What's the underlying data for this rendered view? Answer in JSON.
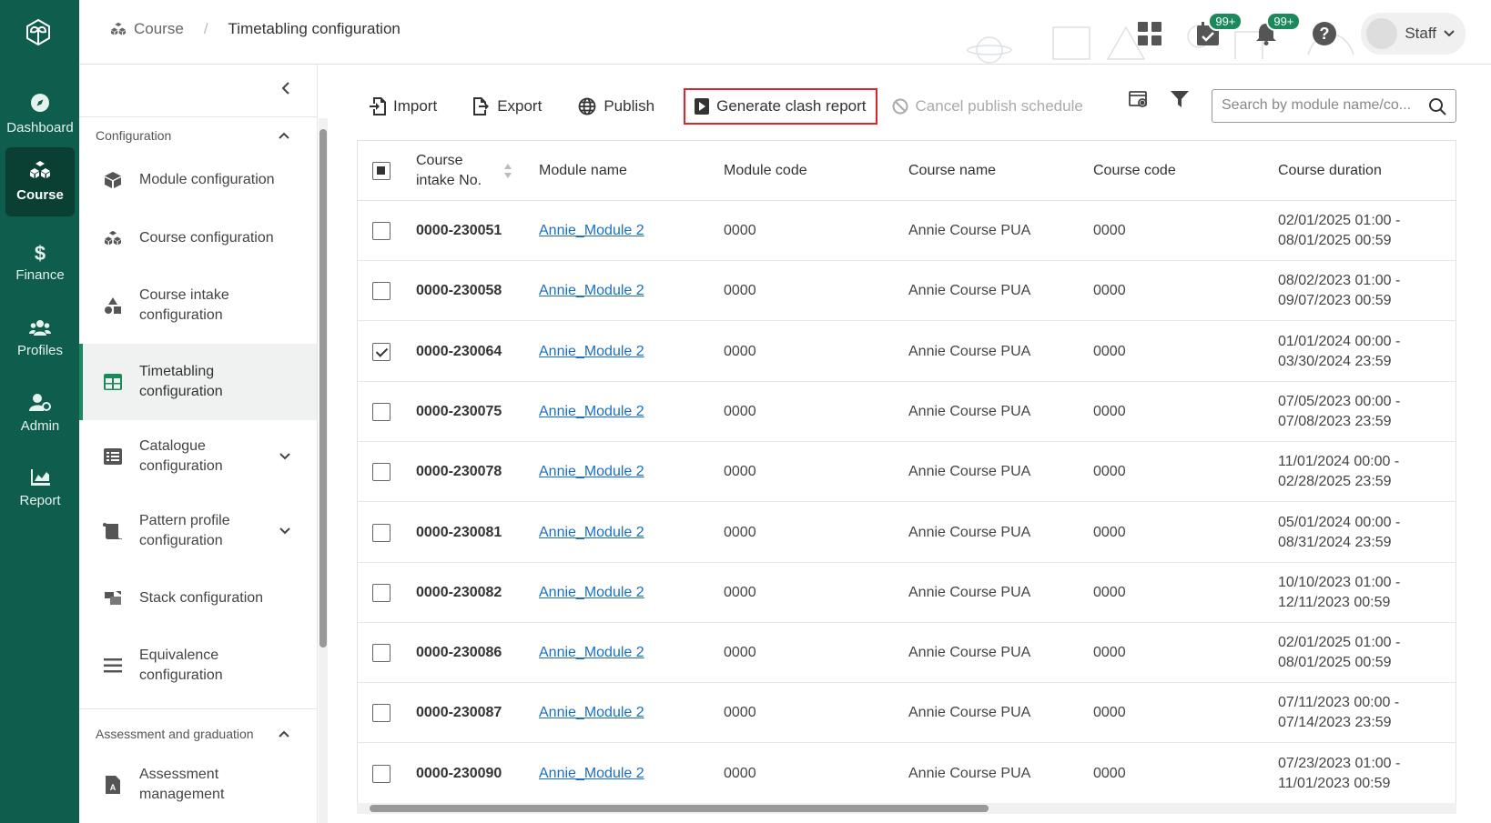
{
  "rail": {
    "items": [
      {
        "label": "Dashboard",
        "icon": "compass-icon"
      },
      {
        "label": "Course",
        "icon": "cubes-icon"
      },
      {
        "label": "Finance",
        "icon": "dollar-icon"
      },
      {
        "label": "Profiles",
        "icon": "users-icon"
      },
      {
        "label": "Admin",
        "icon": "user-gear-icon"
      },
      {
        "label": "Report",
        "icon": "chart-icon"
      }
    ]
  },
  "header": {
    "breadcrumb_root": "Course",
    "breadcrumb_sep": "/",
    "breadcrumb_current": "Timetabling configuration",
    "tasks_badge": "99+",
    "notifications_badge": "99+",
    "user_label": "Staff"
  },
  "sidenav": {
    "section1": "Configuration",
    "items": [
      {
        "label": "Module configuration"
      },
      {
        "label": "Course configuration"
      },
      {
        "label": "Course intake configuration"
      },
      {
        "label": "Timetabling configuration"
      },
      {
        "label": "Catalogue configuration"
      },
      {
        "label": "Pattern profile configuration"
      },
      {
        "label": "Stack configuration"
      },
      {
        "label": "Equivalence configuration"
      }
    ],
    "section2": "Assessment and graduation",
    "items2": [
      {
        "label": "Assessment management"
      }
    ]
  },
  "toolbar": {
    "import": "Import",
    "export": "Export",
    "publish": "Publish",
    "generate": "Generate clash report",
    "cancel": "Cancel publish schedule",
    "search_placeholder": "Search by module name/co..."
  },
  "table": {
    "headers": {
      "intake": "Course intake No.",
      "module_name": "Module name",
      "module_code": "Module code",
      "course_name": "Course name",
      "course_code": "Course code",
      "duration": "Course duration"
    },
    "rows": [
      {
        "intake": "0000-230051",
        "module": "Annie_Module 2",
        "mcode": "0000",
        "course": "Annie Course PUA",
        "ccode": "0000",
        "d1": "02/01/2025 01:00 -",
        "d2": "08/01/2025 00:59",
        "checked": false
      },
      {
        "intake": "0000-230058",
        "module": "Annie_Module 2",
        "mcode": "0000",
        "course": "Annie Course PUA",
        "ccode": "0000",
        "d1": "08/02/2023 01:00 -",
        "d2": "09/07/2023 00:59",
        "checked": false
      },
      {
        "intake": "0000-230064",
        "module": "Annie_Module 2",
        "mcode": "0000",
        "course": "Annie Course PUA",
        "ccode": "0000",
        "d1": "01/01/2024 00:00 -",
        "d2": "03/30/2024 23:59",
        "checked": true
      },
      {
        "intake": "0000-230075",
        "module": "Annie_Module 2",
        "mcode": "0000",
        "course": "Annie Course PUA",
        "ccode": "0000",
        "d1": "07/05/2023 00:00 -",
        "d2": "07/08/2023 23:59",
        "checked": false
      },
      {
        "intake": "0000-230078",
        "module": "Annie_Module 2",
        "mcode": "0000",
        "course": "Annie Course PUA",
        "ccode": "0000",
        "d1": "11/01/2024 00:00 -",
        "d2": "02/28/2025 23:59",
        "checked": false
      },
      {
        "intake": "0000-230081",
        "module": "Annie_Module 2",
        "mcode": "0000",
        "course": "Annie Course PUA",
        "ccode": "0000",
        "d1": "05/01/2024 00:00 -",
        "d2": "08/31/2024 23:59",
        "checked": false
      },
      {
        "intake": "0000-230082",
        "module": "Annie_Module 2",
        "mcode": "0000",
        "course": "Annie Course PUA",
        "ccode": "0000",
        "d1": "10/10/2023 01:00 -",
        "d2": "12/11/2023 00:59",
        "checked": false
      },
      {
        "intake": "0000-230086",
        "module": "Annie_Module 2",
        "mcode": "0000",
        "course": "Annie Course PUA",
        "ccode": "0000",
        "d1": "02/01/2025 01:00 -",
        "d2": "08/01/2025 00:59",
        "checked": false
      },
      {
        "intake": "0000-230087",
        "module": "Annie_Module 2",
        "mcode": "0000",
        "course": "Annie Course PUA",
        "ccode": "0000",
        "d1": "07/11/2023 00:00 -",
        "d2": "07/14/2023 23:59",
        "checked": false
      },
      {
        "intake": "0000-230090",
        "module": "Annie_Module 2",
        "mcode": "0000",
        "course": "Annie Course PUA",
        "ccode": "0000",
        "d1": "07/23/2023 01:00 -",
        "d2": "11/01/2023 00:59",
        "checked": false
      }
    ]
  }
}
